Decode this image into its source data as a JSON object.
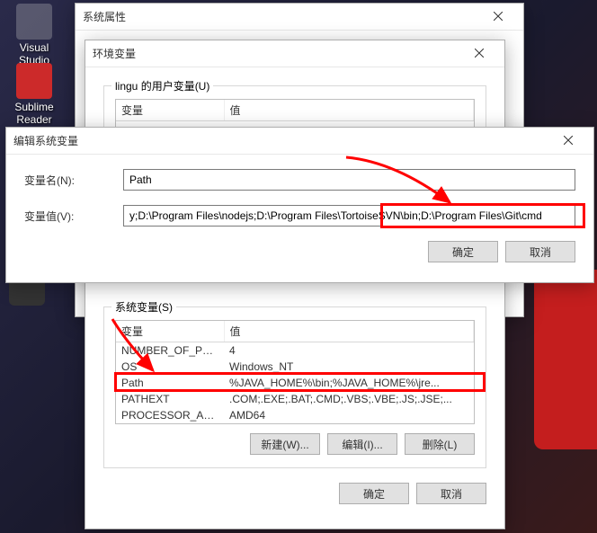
{
  "desktop": {
    "icon1": "Visual Studio Code",
    "icon2": "Sublime Reader",
    "icon3": ""
  },
  "sysprop": {
    "title": "系统属性"
  },
  "envvar": {
    "title": "环境变量",
    "user_legend": "lingu 的用户变量(U)",
    "sys_legend": "系统变量(S)",
    "col_var": "变量",
    "col_val": "值",
    "user_rows": [
      {
        "name": "",
        "value": ""
      }
    ],
    "sys_rows": [
      {
        "name": "NUMBER_OF_PR...",
        "value": "4"
      },
      {
        "name": "OS",
        "value": "Windows_NT"
      },
      {
        "name": "Path",
        "value": "%JAVA_HOME%\\bin;%JAVA_HOME%\\jre..."
      },
      {
        "name": "PATHEXT",
        "value": ".COM;.EXE;.BAT;.CMD;.VBS;.VBE;.JS;.JSE;..."
      },
      {
        "name": "PROCESSOR_AR...",
        "value": "AMD64"
      }
    ],
    "btn_new": "新建(W)...",
    "btn_edit": "编辑(I)...",
    "btn_del": "删除(L)",
    "btn_ok": "确定",
    "btn_cancel": "取消"
  },
  "editdlg": {
    "title": "编辑系统变量",
    "label_name": "变量名(N):",
    "label_value": "变量值(V):",
    "field_name": "Path",
    "field_value": "y;D:\\Program Files\\nodejs;D:\\Program Files\\TortoiseSVN\\bin;D:\\Program Files\\Git\\cmd",
    "btn_ok": "确定",
    "btn_cancel": "取消"
  }
}
